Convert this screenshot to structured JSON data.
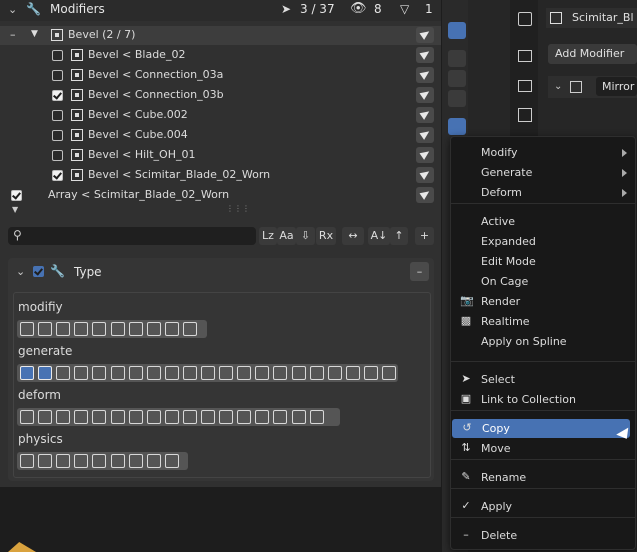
{
  "header": {
    "title": "Modifiers",
    "selected_count": "3 / 37",
    "visible_count": "8",
    "filter_count": "1"
  },
  "tree": {
    "group_label": "Bevel (2 / 7)",
    "items": [
      {
        "label": "Bevel < Blade_02",
        "checked": false
      },
      {
        "label": "Bevel < Connection_03a",
        "checked": false
      },
      {
        "label": "Bevel < Connection_03b",
        "checked": true
      },
      {
        "label": "Bevel < Cube.002",
        "checked": false
      },
      {
        "label": "Bevel < Cube.004",
        "checked": false
      },
      {
        "label": "Bevel < Hilt_OH_01",
        "checked": false
      },
      {
        "label": "Bevel < Scimitar_Blade_02_Worn",
        "checked": true
      }
    ],
    "array_label": "Array < Scimitar_Blade_02_Worn"
  },
  "search": {
    "placeholder": "",
    "buttons": [
      "Lz",
      "Aa",
      "Rx"
    ]
  },
  "type_panel": {
    "title": "Type",
    "categories": [
      "modifiy",
      "generate",
      "deform",
      "physics"
    ]
  },
  "right": {
    "object_name": "Scimitar_Bl",
    "add_modifier": "Add Modifier",
    "mirror": "Mirror"
  },
  "menu": {
    "items": [
      {
        "label": "Modify",
        "submenu": true
      },
      {
        "label": "Generate",
        "submenu": true
      },
      {
        "label": "Deform",
        "submenu": true
      },
      {
        "label": "Active"
      },
      {
        "label": "Expanded"
      },
      {
        "label": "Edit Mode"
      },
      {
        "label": "On Cage"
      },
      {
        "label": "Render"
      },
      {
        "label": "Realtime"
      },
      {
        "label": "Apply on Spline"
      },
      {
        "label": "Select"
      },
      {
        "label": "Link to Collection"
      },
      {
        "label": "Copy",
        "highlight": true
      },
      {
        "label": "Move"
      },
      {
        "label": "Rename"
      },
      {
        "label": "Apply"
      },
      {
        "label": "Delete"
      }
    ]
  },
  "colors": {
    "highlight": "#4772b3",
    "panel": "#303030",
    "menu": "#181818"
  }
}
